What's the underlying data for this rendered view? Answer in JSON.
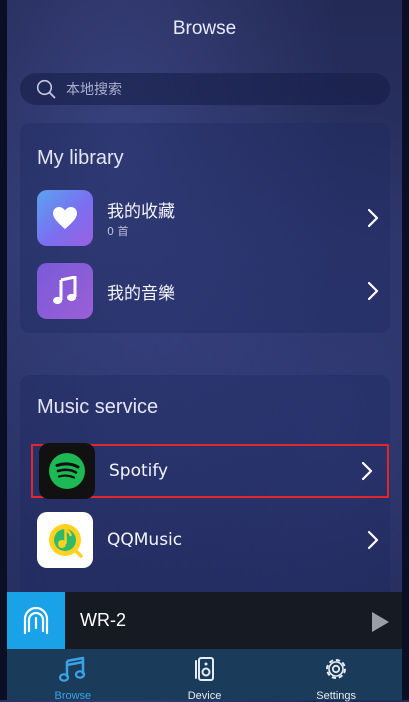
{
  "header": {
    "title": "Browse"
  },
  "search": {
    "placeholder": "本地搜索"
  },
  "library": {
    "title": "My library",
    "items": [
      {
        "label": "我的收藏",
        "sub": "0 首",
        "icon": "heart-icon"
      },
      {
        "label": "我的音樂",
        "icon": "music-note-icon"
      }
    ]
  },
  "services": {
    "title": "Music service",
    "items": [
      {
        "label": "Spotify",
        "icon": "spotify-icon",
        "highlighted": true
      },
      {
        "label": "QQMusic",
        "icon": "qqmusic-icon"
      }
    ]
  },
  "player": {
    "device": "WR-2",
    "icon": "wifi-speaker-icon",
    "play_icon": "play-icon"
  },
  "tabs": [
    {
      "label": "Browse",
      "icon": "music-note-icon",
      "active": true
    },
    {
      "label": "Device",
      "icon": "speaker-icon",
      "active": false
    },
    {
      "label": "Settings",
      "icon": "gear-icon",
      "active": false
    }
  ],
  "colors": {
    "accent": "#1aa2e8",
    "highlight_border": "#e0272c",
    "tabbar": "#1b3b5a",
    "spotify_green": "#1db954"
  }
}
